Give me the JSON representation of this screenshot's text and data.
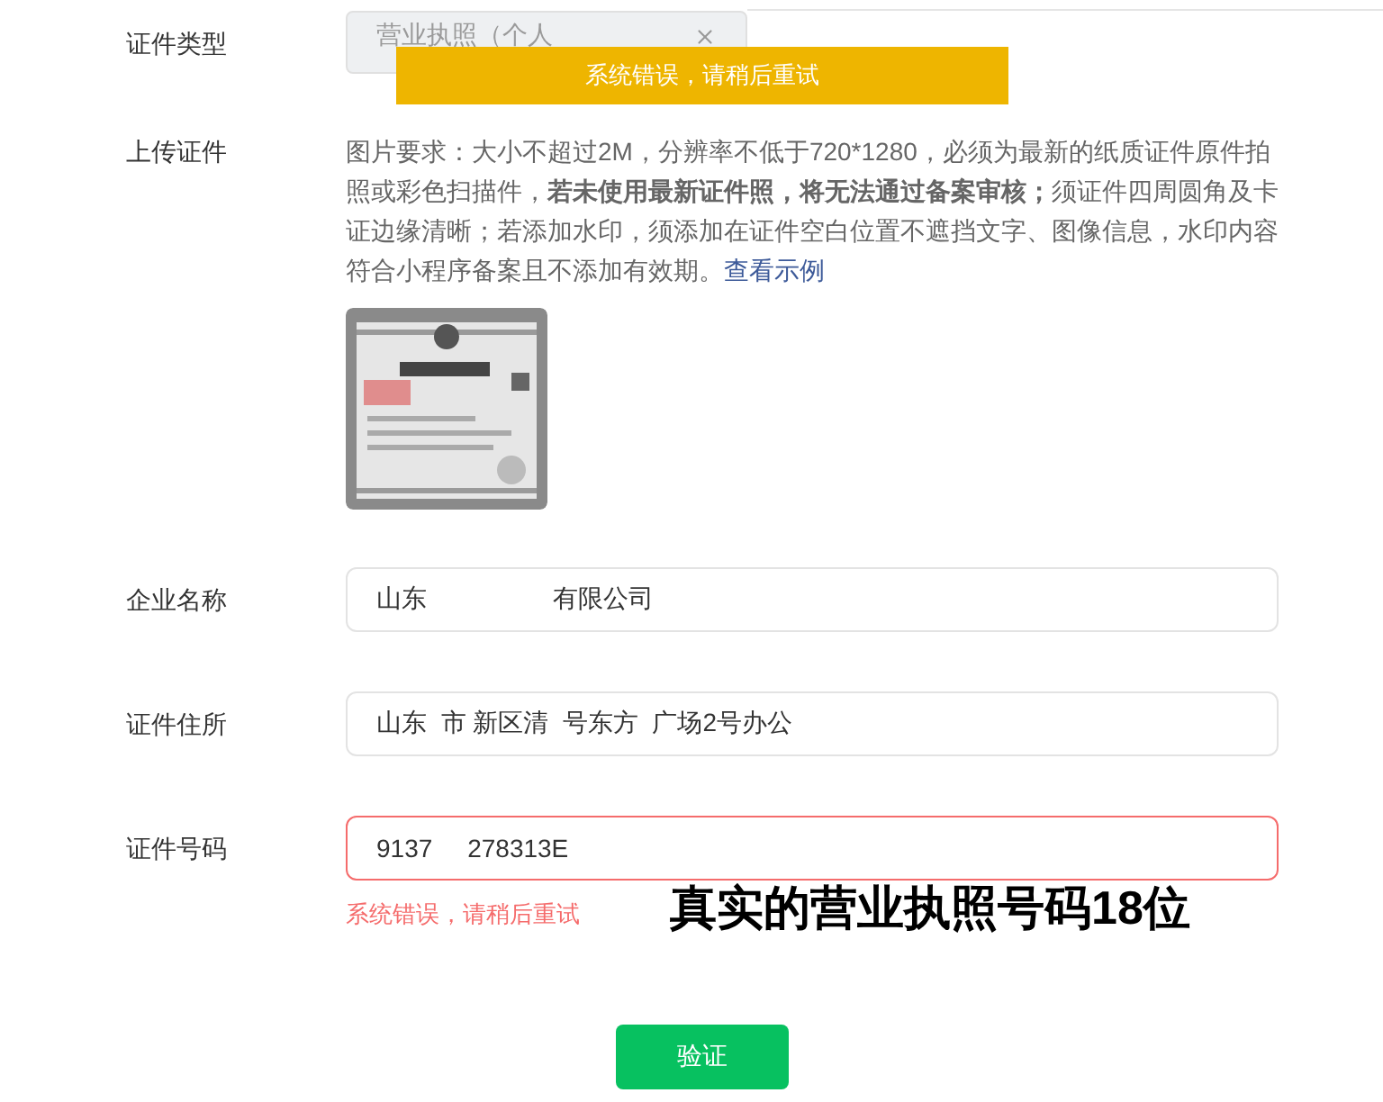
{
  "toast": {
    "text": "系统错误，请稍后重试"
  },
  "fields": [
    {
      "kind": "select",
      "label": "证件类型",
      "placeholder": "营业执照（个人",
      "disabled": true
    },
    {
      "kind": "upload",
      "label": "上传证件",
      "hint_parts": [
        "图片要求：大小不超过2M，分辨率不低于720*1280，必须为最新的纸质证件原件拍照或彩色扫描件，**若未使用最新证件照，将无法通过备案审核；**须证件四周圆角及卡证边缘清晰；若添加水印，须添加在证件空白位置不遮挡文字、图像信息，水印内容符合小程序备案且不添加有效期。"
      ],
      "link": "查看示例"
    },
    {
      "kind": "input",
      "label": "企业名称",
      "value": "山东　　　　　有限公司",
      "invalid": false
    },
    {
      "kind": "input",
      "label": "证件住所",
      "value": "山东  市 新区清  号东方  广场2号办公",
      "invalid": false
    },
    {
      "kind": "input",
      "label": "证件号码",
      "value": "9137     278313E",
      "invalid": true,
      "error": "系统错误，请稍后重试"
    }
  ],
  "annotation": "真实的营业执照号码18位",
  "submit": {
    "label": "验证"
  }
}
